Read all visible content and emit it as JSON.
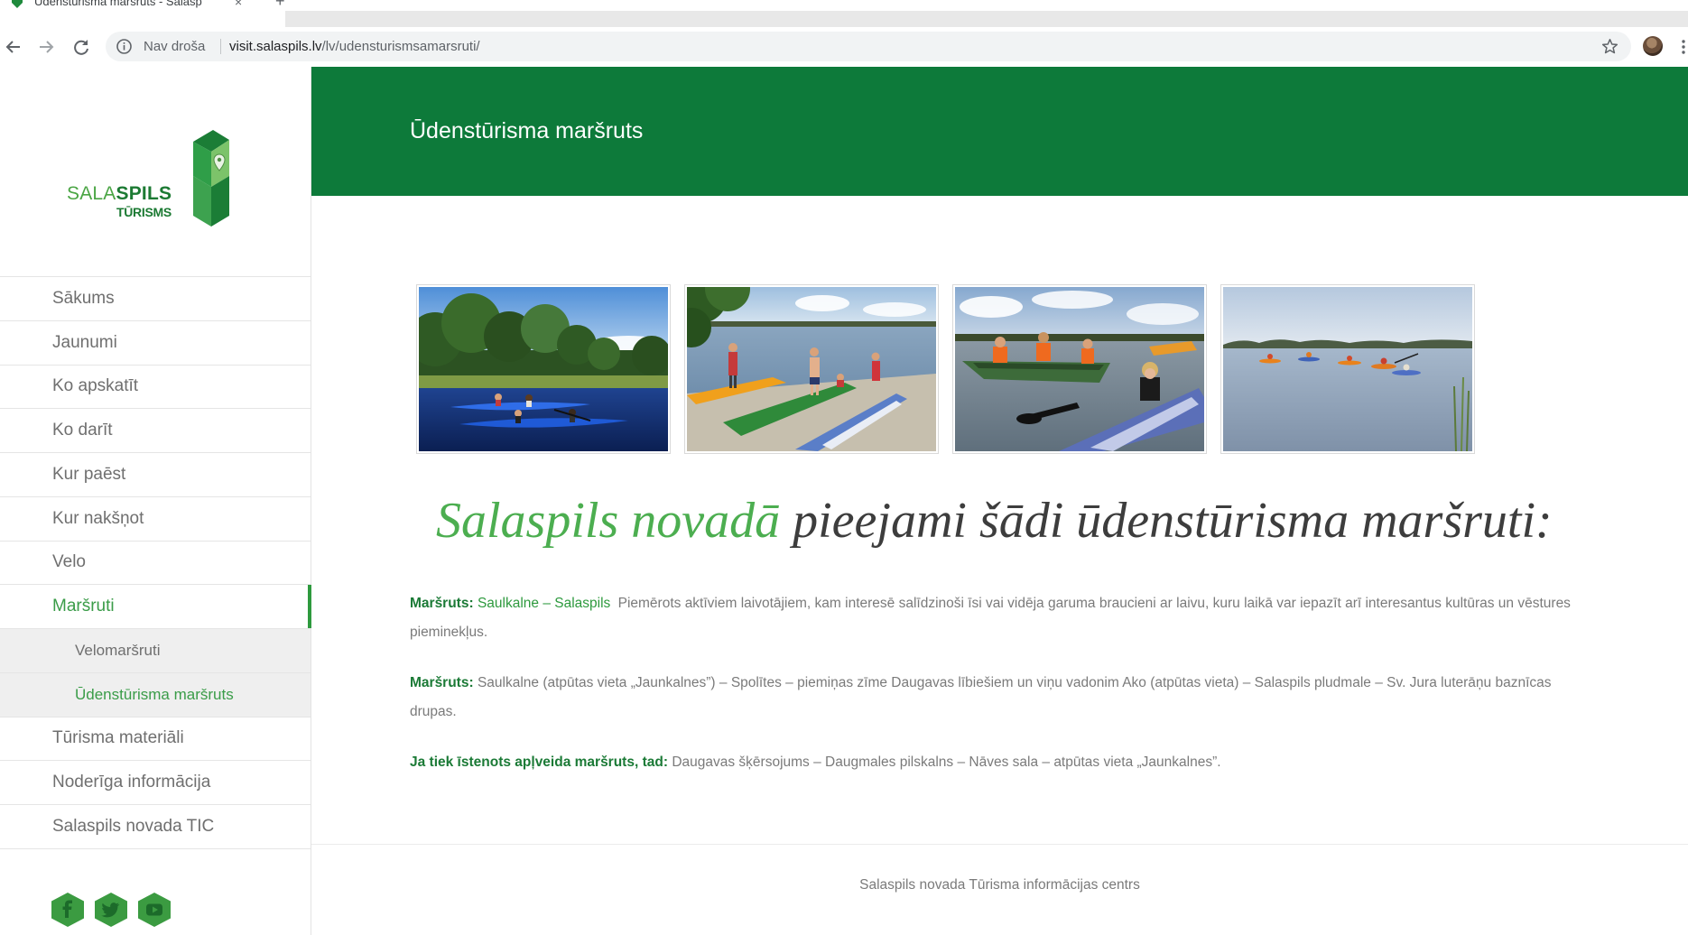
{
  "browser": {
    "tab_title": "Ūdenstūrisma maršruts - Salasp",
    "tab_close": "×",
    "new_tab": "+",
    "security_label": "Nav droša",
    "url_host": "visit.salaspils.lv",
    "url_path": "/lv/udensturismsamarsruti/",
    "icons": [
      "back-icon",
      "forward-icon",
      "reload-icon",
      "info-icon",
      "star-icon",
      "avatar",
      "menu-icon"
    ]
  },
  "logo": {
    "word_light": "SALA",
    "word_bold": "SPILS",
    "subtitle": "TŪRISMS"
  },
  "nav": {
    "items": [
      {
        "label": "Sākums"
      },
      {
        "label": "Jaunumi"
      },
      {
        "label": "Ko apskatīt"
      },
      {
        "label": "Ko darīt"
      },
      {
        "label": "Kur paēst"
      },
      {
        "label": "Kur nakšņot"
      },
      {
        "label": "Velo"
      },
      {
        "label": "Maršruti"
      },
      {
        "label": "Velomaršruti"
      },
      {
        "label": "Ūdenstūrisma maršruts"
      },
      {
        "label": "Tūrisma materiāli"
      },
      {
        "label": "Noderīga informācija"
      },
      {
        "label": "Salaspils novada TIC"
      }
    ]
  },
  "social": {
    "icons": [
      "facebook-icon",
      "twitter-icon",
      "youtube-icon"
    ]
  },
  "header": {
    "title": "Ūdenstūrisma maršruts"
  },
  "intro": {
    "heading_green": "Salaspils novadā",
    "heading_rest": "pieejami šādi ūdenstūrisma maršruti:"
  },
  "routes": [
    {
      "label": "Maršruts:",
      "highlight": "Saulkalne – Salaspils",
      "text": "Piemērots aktīviem laivotājiem, kam interesē salīdzinoši īsi vai vidēja garuma braucieni ar laivu, kuru laikā var iepazīt arī interesantus kultūras un vēstures pieminekļus."
    },
    {
      "label": "Maršruts:",
      "text": "Saulkalne (atpūtas vieta „Jaunkalnes”) – Spolītes – piemiņas zīme Daugavas lībiešiem un viņu vadonim Ako (atpūtas vieta) – Salaspils pludmale – Sv. Jura luterāņu baznīcas drupas."
    },
    {
      "label": "Ja tiek īstenots apļveida maršruts, tad:",
      "text": "Daugavas šķērsojums – Daugmales pilskalns – Nāves sala – atpūtas vieta „Jaunkalnes”."
    }
  ],
  "footer": {
    "text": "Salaspils novada Tūrisma informācijas centrs"
  },
  "colors": {
    "header_green": "#0d7a3a",
    "nav_active": "#3a9c48",
    "label_green": "#1b7a36",
    "heading_green": "#4cae50",
    "body_text": "#7a7a7a"
  }
}
